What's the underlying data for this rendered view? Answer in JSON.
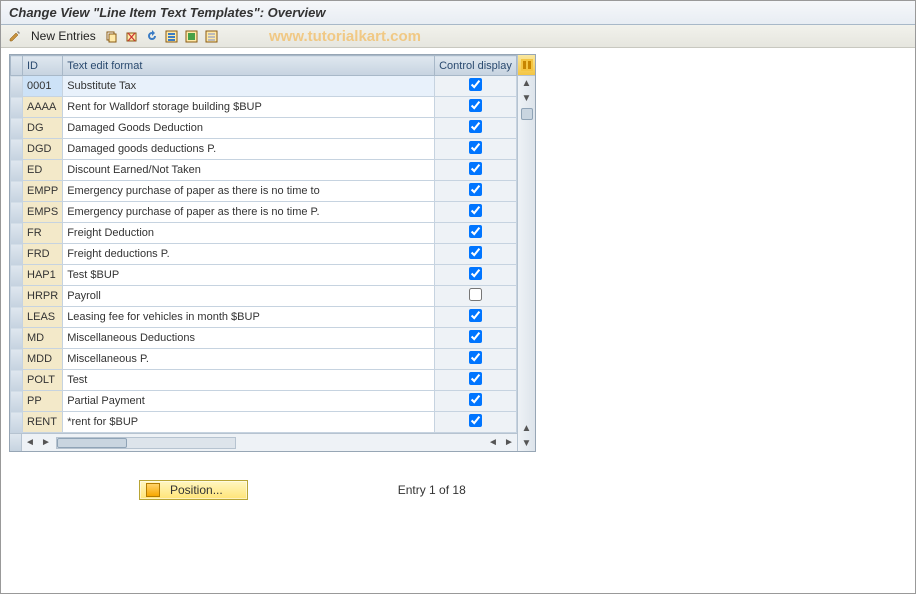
{
  "title": "Change View \"Line Item Text Templates\": Overview",
  "watermark": "www.tutorialkart.com",
  "toolbar": {
    "new_entries_label": "New Entries"
  },
  "columns": {
    "id": "ID",
    "text": "Text edit format",
    "control": "Control display"
  },
  "rows": [
    {
      "id": "0001",
      "text": "Substitute Tax",
      "control": true,
      "first": true
    },
    {
      "id": "AAAA",
      "text": "Rent for Walldorf storage building $BUP",
      "control": true
    },
    {
      "id": "DG",
      "text": "Damaged Goods Deduction",
      "control": true
    },
    {
      "id": "DGD",
      "text": "Damaged goods deductions P.",
      "control": true
    },
    {
      "id": "ED",
      "text": "Discount Earned/Not Taken",
      "control": true
    },
    {
      "id": "EMPP",
      "text": "Emergency purchase of paper as there is no time to",
      "control": true
    },
    {
      "id": "EMPS",
      "text": "Emergency purchase of paper as there is no time P.",
      "control": true
    },
    {
      "id": "FR",
      "text": "Freight Deduction",
      "control": true
    },
    {
      "id": "FRD",
      "text": "Freight deductions P.",
      "control": true
    },
    {
      "id": "HAP1",
      "text": "Test $BUP",
      "control": true
    },
    {
      "id": "HRPR",
      "text": "Payroll",
      "control": false
    },
    {
      "id": "LEAS",
      "text": "Leasing fee for vehicles in month $BUP",
      "control": true
    },
    {
      "id": "MD",
      "text": "Miscellaneous Deductions",
      "control": true
    },
    {
      "id": "MDD",
      "text": "Miscellaneous P.",
      "control": true
    },
    {
      "id": "POLT",
      "text": "Test",
      "control": true
    },
    {
      "id": "PP",
      "text": "Partial Payment",
      "control": true
    },
    {
      "id": "RENT",
      "text": "*rent for $BUP",
      "control": true
    }
  ],
  "footer": {
    "position_label": "Position...",
    "entry_status": "Entry 1 of 18"
  }
}
